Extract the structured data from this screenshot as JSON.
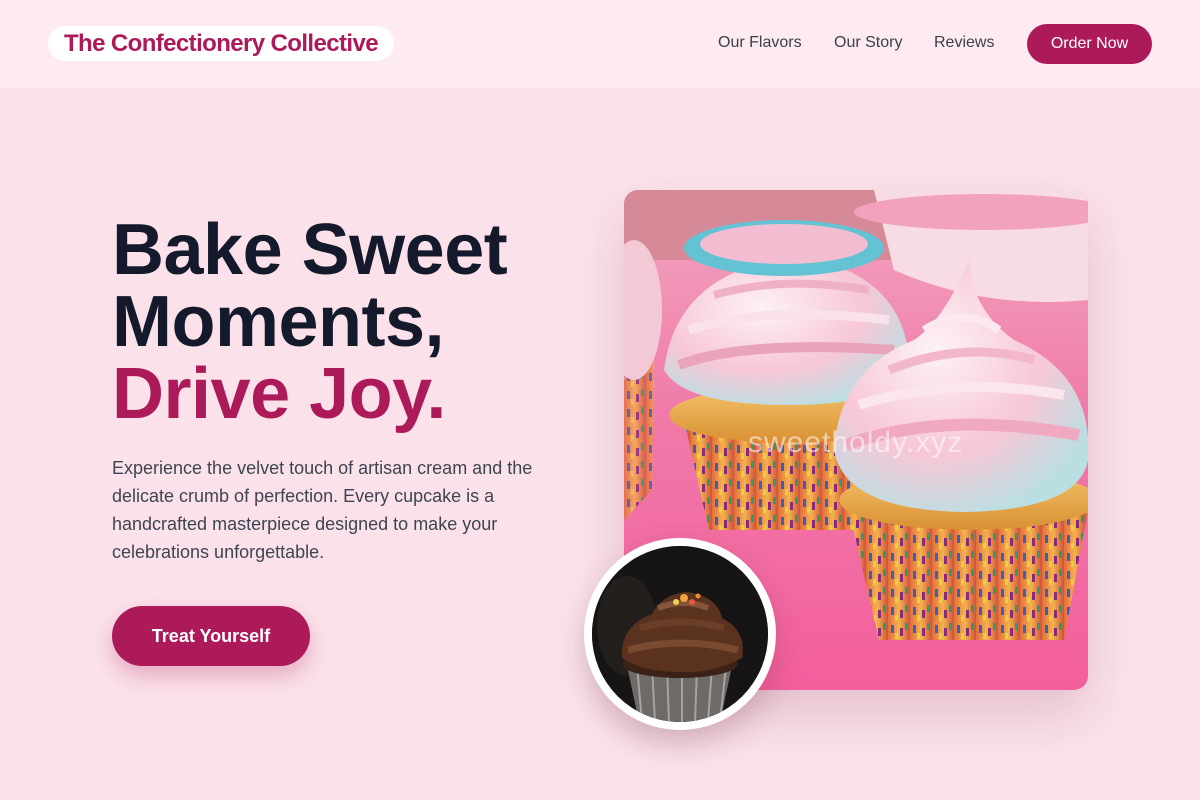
{
  "brand": {
    "name": "The Confectionery Collective"
  },
  "nav": {
    "links": [
      "Our Flavors",
      "Our Story",
      "Reviews"
    ],
    "order_label": "Order Now"
  },
  "hero": {
    "headline": [
      "Bake Sweet",
      "Moments,",
      "Drive Joy."
    ],
    "description": "Experience the velvet touch of artisan cream and the delicate crumb of perfection. Every cupcake is a handcrafted masterpiece designed to make your celebrations unforgettable.",
    "cta_label": "Treat Yourself",
    "watermark": "sweetholdy.xyz"
  },
  "colors": {
    "brand": "#ad1a5a",
    "page_background": "#fbe2ea",
    "nav_background": "#fdebf1",
    "heading": "#141a2b"
  }
}
